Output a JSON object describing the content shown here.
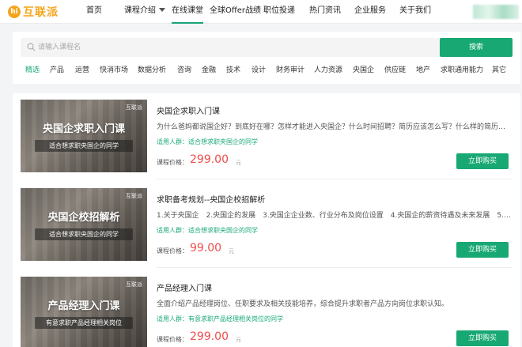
{
  "brand": {
    "name": "互联派",
    "mark": "hi"
  },
  "nav": {
    "items": [
      {
        "label": "首页"
      },
      {
        "label": "课程介绍"
      },
      {
        "label": "在线课堂"
      },
      {
        "label": "全球Offer战绩"
      },
      {
        "label": "职位投递"
      },
      {
        "label": "热门资讯"
      },
      {
        "label": "企业服务"
      },
      {
        "label": "关于我们"
      }
    ],
    "active_index": 2
  },
  "search": {
    "placeholder": "请输入课程名",
    "button_label": "搜索"
  },
  "categories": {
    "items": [
      "精选",
      "产品",
      "运营",
      "快消市场",
      "数据分析",
      "咨询",
      "金融",
      "技术",
      "设计",
      "财务审计",
      "人力资源",
      "央国企",
      "供应链",
      "地产",
      "求职通用能力",
      "其它"
    ],
    "active_index": 0
  },
  "courses": [
    {
      "thumb_brand": "互联派",
      "thumb_title": "央国企求职入门课",
      "thumb_sub": "适合想求职央国企的同学",
      "title": "央国企求职入门课",
      "desc": "为什么爸妈都说国企好？到底好在哪？怎样才能进入央国企？什么时间招聘？简历应该怎么写？什么样的简历才被央...",
      "audience": "适用人群：适合想求职央国企的同学",
      "price_label": "课程价格：",
      "price": "299.00",
      "unit": "元",
      "buy_label": "立即购买"
    },
    {
      "thumb_brand": "互联派",
      "thumb_title": "央国企校招解析",
      "thumb_sub": "适合想求职央国企的同学",
      "title": "求职备考规划--央国企校招解析",
      "desc": "1.关于央国企　2.央国企的发展　3.央国企企业数、行业分布及岗位设置　4.央国企的薪资待遇及未来发展　5.央国...",
      "audience": "适用人群：适合想求职央国企的同学",
      "price_label": "课程价格：",
      "price": "99.00",
      "unit": "元",
      "buy_label": "立即购买"
    },
    {
      "thumb_brand": "互联派",
      "thumb_title": "产品经理入门课",
      "thumb_sub": "有意求职产品经理相关岗位",
      "title": "产品经理入门课",
      "desc": "全面介绍产品经理岗位、任职要求及相关技能培养，综合提升求职者产品方向岗位求职认知。",
      "audience": "适用人群：有意求职产品经理相关岗位的同学",
      "price_label": "课程价格：",
      "price": "299.00",
      "unit": "元",
      "buy_label": "立即购买"
    }
  ],
  "colors": {
    "accent": "#18a874",
    "price": "#ef4c4c",
    "brand": "#f4a51c"
  }
}
